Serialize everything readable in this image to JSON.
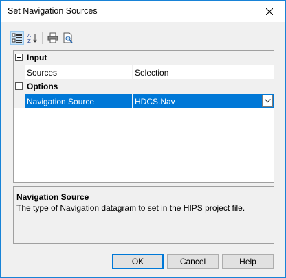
{
  "window": {
    "title": "Set Navigation Sources"
  },
  "grid": {
    "categories": [
      {
        "label": "Input",
        "rows": [
          {
            "name": "Sources",
            "value": "Selection"
          }
        ]
      },
      {
        "label": "Options",
        "rows": [
          {
            "name": "Navigation Source",
            "value": "HDCS.Nav",
            "selected": true
          }
        ]
      }
    ]
  },
  "description": {
    "title": "Navigation Source",
    "text": "The type of Navigation datagram to set in the HIPS project file."
  },
  "buttons": {
    "ok": "OK",
    "cancel": "Cancel",
    "help": "Help"
  },
  "colors": {
    "accent": "#0078d7",
    "border": "#1883d7"
  }
}
